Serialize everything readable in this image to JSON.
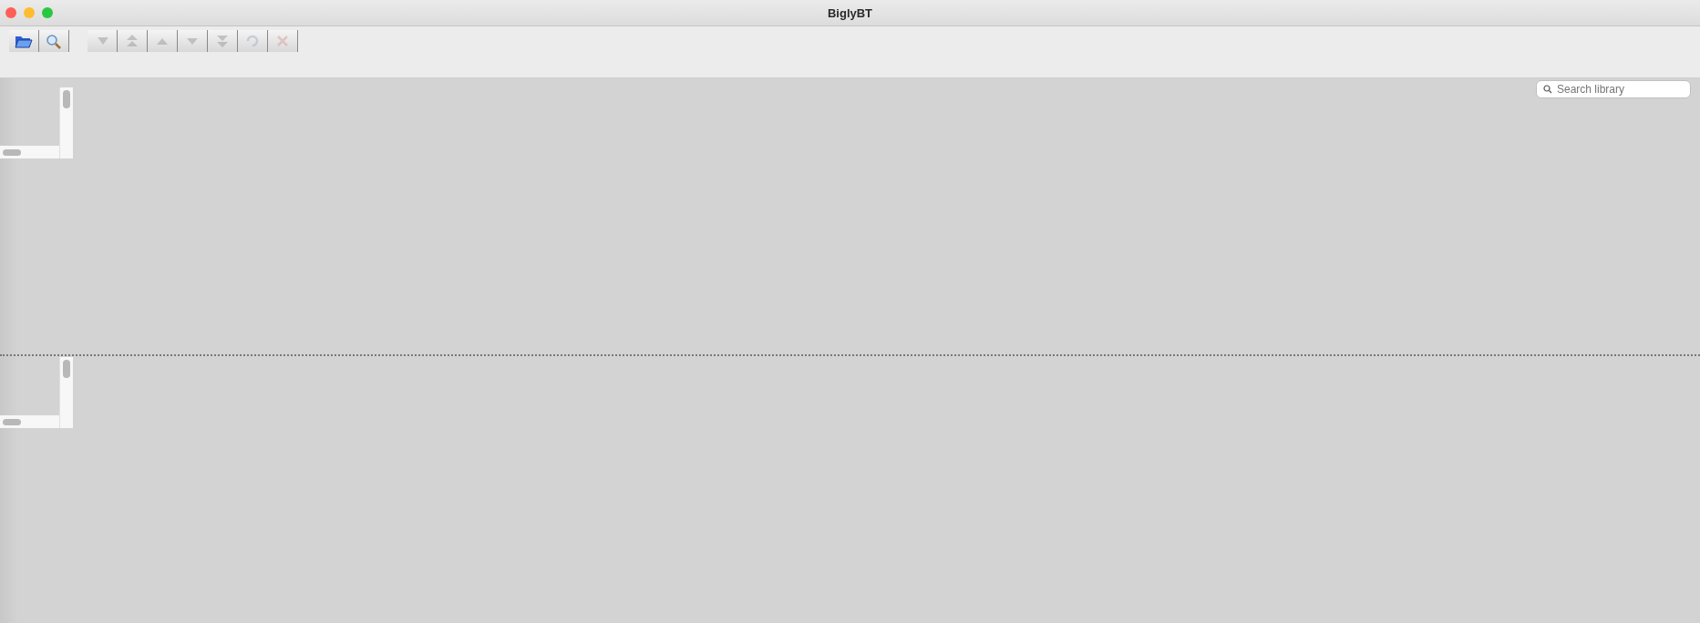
{
  "window": {
    "title": "BiglyBT"
  },
  "toolbar": {
    "groups": [
      {
        "buttons": [
          {
            "kind": "open",
            "disabled": false
          },
          {
            "kind": "search",
            "disabled": false
          }
        ]
      },
      {
        "buttons": [
          {
            "kind": "start",
            "disabled": true
          },
          {
            "kind": "top",
            "disabled": true
          },
          {
            "kind": "up",
            "disabled": true
          },
          {
            "kind": "down",
            "disabled": true
          },
          {
            "kind": "bottom",
            "disabled": true
          },
          {
            "kind": "refresh",
            "disabled": true
          },
          {
            "kind": "remove",
            "disabled": true
          }
        ]
      }
    ]
  },
  "search": {
    "placeholder": "Search library"
  },
  "panes": [
    {
      "kind": "list"
    },
    {
      "kind": "list"
    }
  ]
}
